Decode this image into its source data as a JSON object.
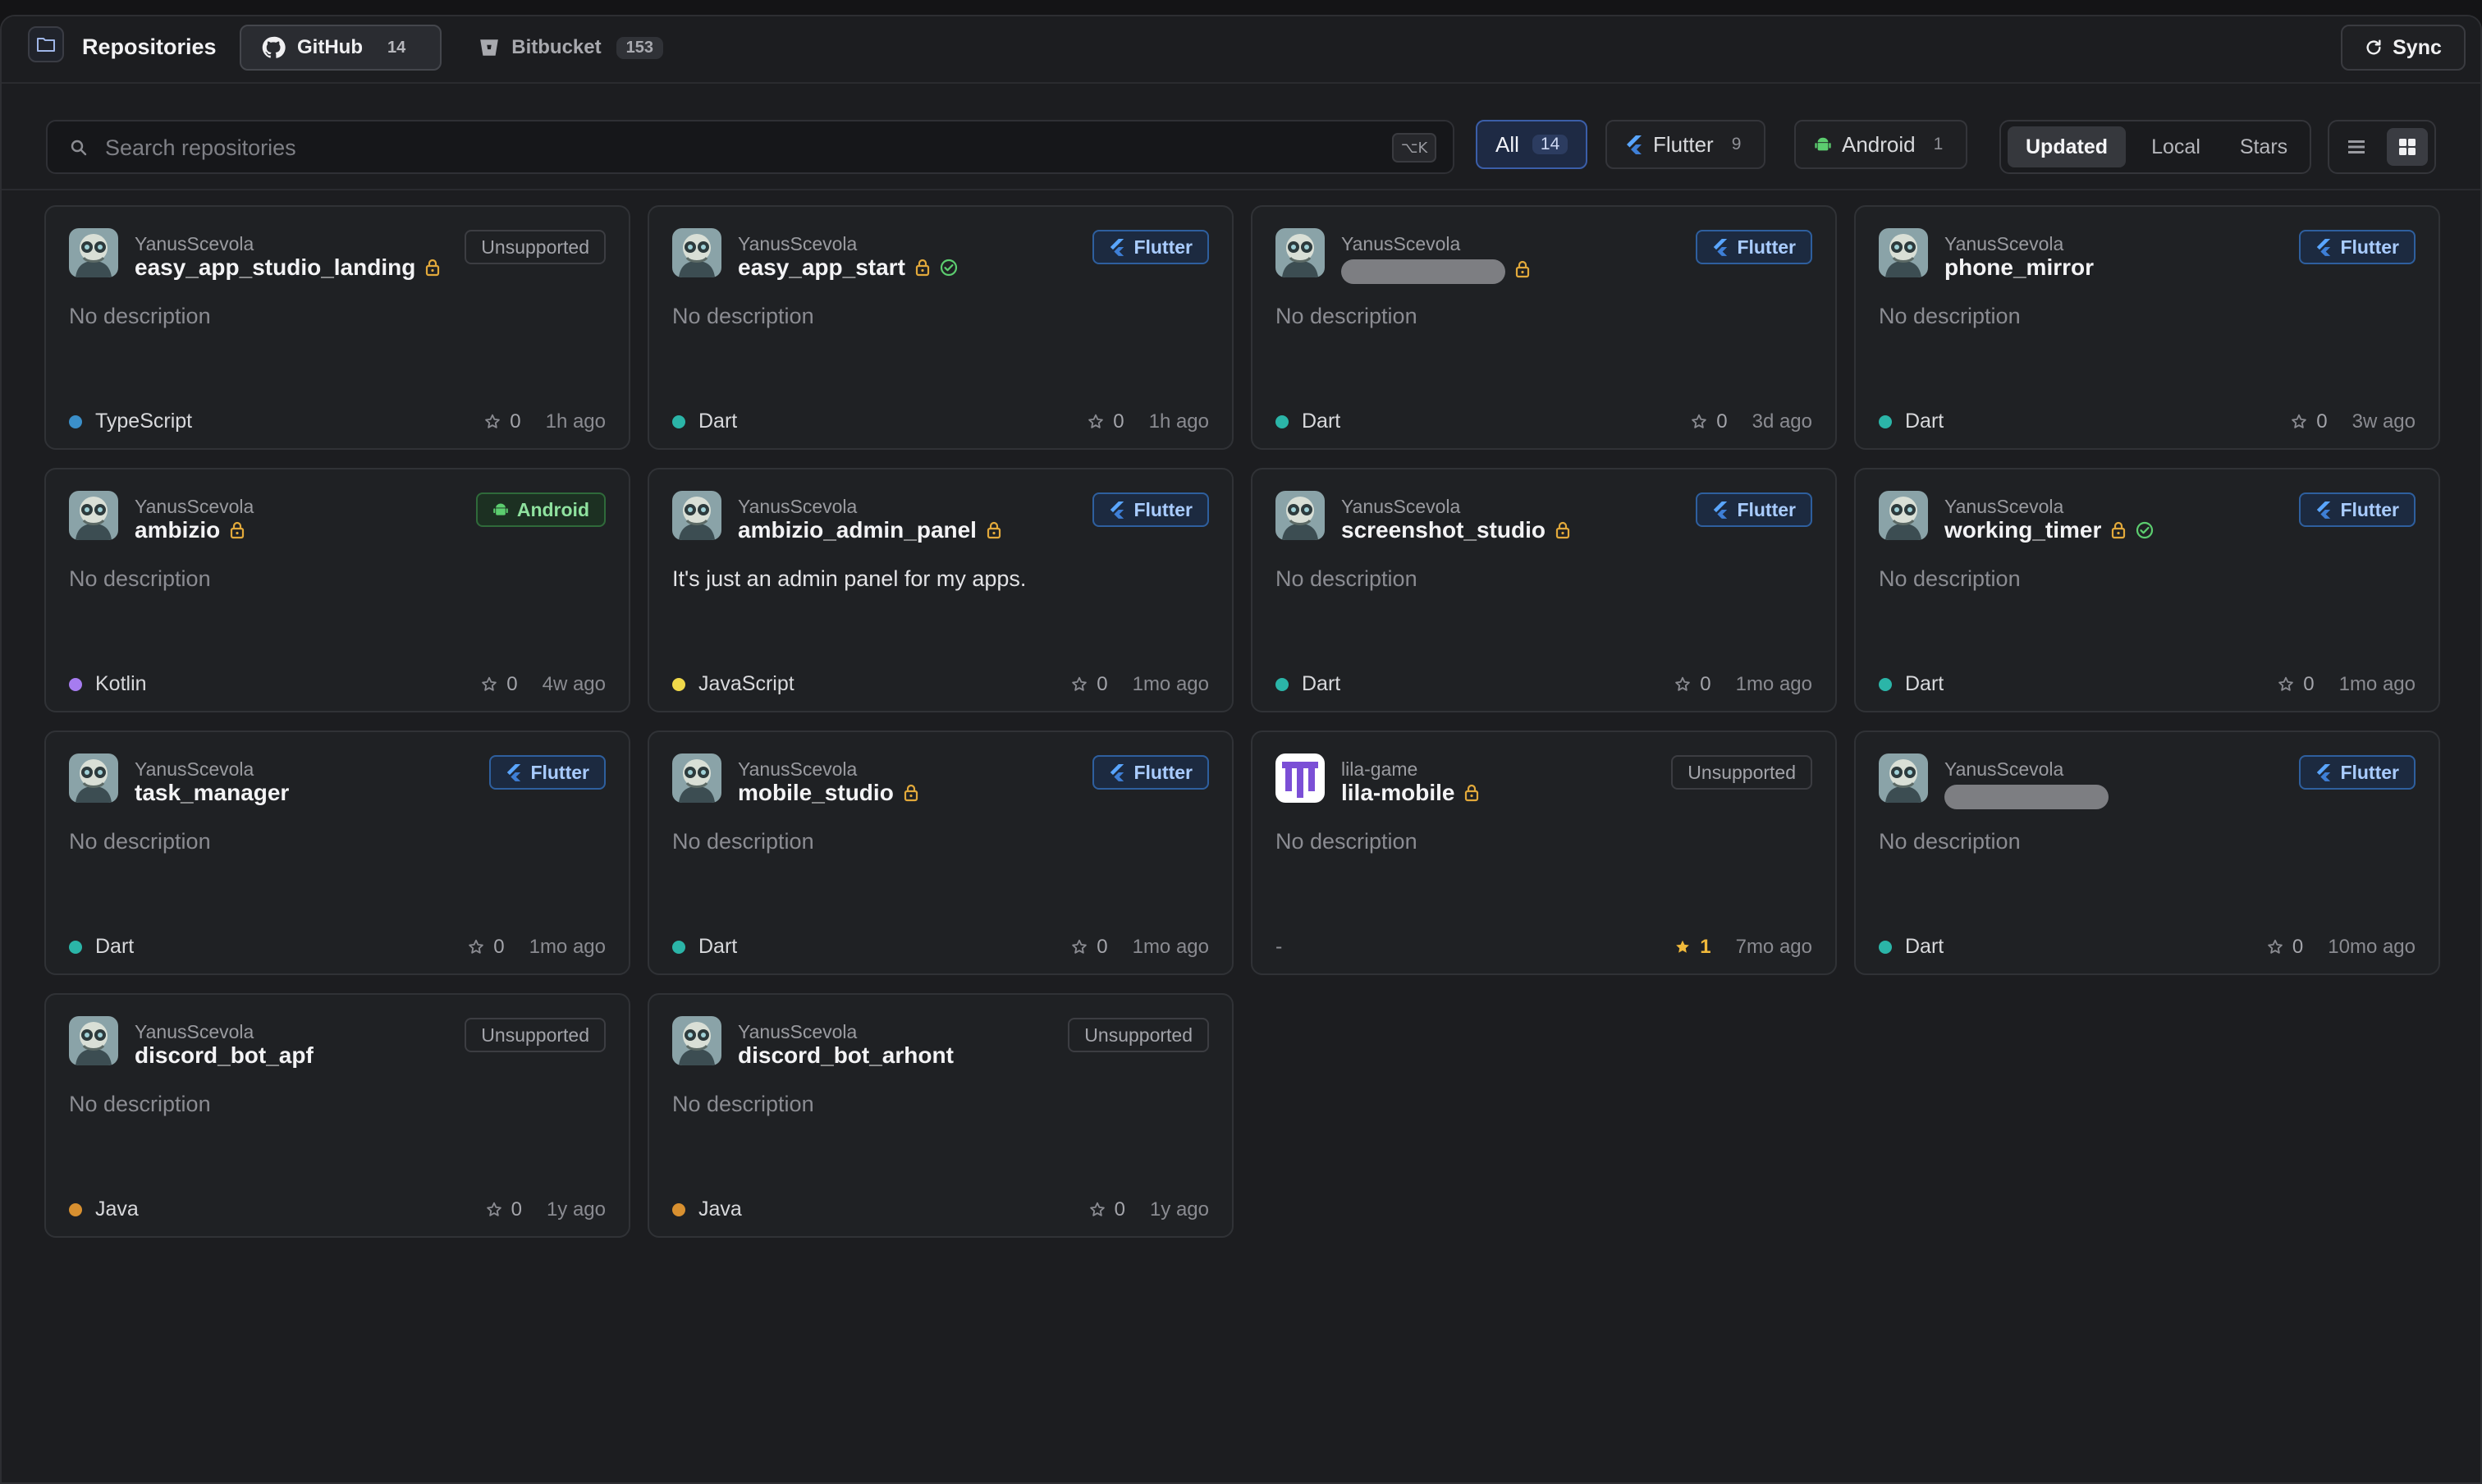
{
  "header": {
    "title": "Repositories",
    "tabs": [
      {
        "label": "GitHub",
        "count": "14"
      },
      {
        "label": "Bitbucket",
        "count": "153"
      }
    ],
    "sync_label": "Sync"
  },
  "filters": {
    "search_placeholder": "Search repositories",
    "shortcut": "⌥K",
    "chips": [
      {
        "label": "All",
        "count": "14"
      },
      {
        "label": "Flutter",
        "count": "9"
      },
      {
        "label": "Android",
        "count": "1"
      }
    ],
    "sort": [
      "Updated",
      "Local",
      "Stars"
    ]
  },
  "colors": {
    "flutter": "#5aa6ff",
    "android": "#5ccd6f",
    "lock": "#e2a93b",
    "check": "#5ccd6f",
    "star_active": "#f0b93b"
  },
  "cards": [
    {
      "owner": "YanusScevola",
      "name": "easy_app_studio_landing",
      "lock": true,
      "check": false,
      "badge": "Unsupported",
      "desc": "No description",
      "lang": "TypeScript",
      "lang_color": "#3b8fc9",
      "stars": "0",
      "time": "1h ago"
    },
    {
      "owner": "YanusScevola",
      "name": "easy_app_start",
      "lock": true,
      "check": true,
      "badge": "Flutter",
      "desc": "No description",
      "lang": "Dart",
      "lang_color": "#2bb5a8",
      "stars": "0",
      "time": "1h ago"
    },
    {
      "owner": "YanusScevola",
      "name": "",
      "lock": true,
      "check": false,
      "badge": "Flutter",
      "desc": "No description",
      "lang": "Dart",
      "lang_color": "#2bb5a8",
      "stars": "0",
      "time": "3d ago"
    },
    {
      "owner": "YanusScevola",
      "name": "phone_mirror",
      "lock": false,
      "check": false,
      "badge": "Flutter",
      "desc": "No description",
      "lang": "Dart",
      "lang_color": "#2bb5a8",
      "stars": "0",
      "time": "3w ago"
    },
    {
      "owner": "YanusScevola",
      "name": "ambizio",
      "lock": true,
      "check": false,
      "badge": "Android",
      "desc": "No description",
      "lang": "Kotlin",
      "lang_color": "#a67cf0",
      "stars": "0",
      "time": "4w ago"
    },
    {
      "owner": "YanusScevola",
      "name": "ambizio_admin_panel",
      "lock": true,
      "check": false,
      "badge": "Flutter",
      "desc": "It's just an admin panel for my apps.",
      "lang": "JavaScript",
      "lang_color": "#f0d94a",
      "stars": "0",
      "time": "1mo ago"
    },
    {
      "owner": "YanusScevola",
      "name": "screenshot_studio",
      "lock": true,
      "check": false,
      "badge": "Flutter",
      "desc": "No description",
      "lang": "Dart",
      "lang_color": "#2bb5a8",
      "stars": "0",
      "time": "1mo ago"
    },
    {
      "owner": "YanusScevola",
      "name": "working_timer",
      "lock": true,
      "check": true,
      "badge": "Flutter",
      "desc": "No description",
      "lang": "Dart",
      "lang_color": "#2bb5a8",
      "stars": "0",
      "time": "1mo ago"
    },
    {
      "owner": "YanusScevola",
      "name": "task_manager",
      "lock": false,
      "check": false,
      "badge": "Flutter",
      "desc": "No description",
      "lang": "Dart",
      "lang_color": "#2bb5a8",
      "stars": "0",
      "time": "1mo ago"
    },
    {
      "owner": "YanusScevola",
      "name": "mobile_studio",
      "lock": true,
      "check": false,
      "badge": "Flutter",
      "desc": "No description",
      "lang": "Dart",
      "lang_color": "#2bb5a8",
      "stars": "0",
      "time": "1mo ago"
    },
    {
      "owner": "lila-game",
      "name": "lila-mobile",
      "lock": true,
      "check": false,
      "badge": "Unsupported",
      "desc": "No description",
      "lang": "-",
      "lang_color": "",
      "stars": "1",
      "time": "7mo ago",
      "avatar": "lila"
    },
    {
      "owner": "YanusScevola",
      "name": "",
      "lock": false,
      "check": false,
      "badge": "Flutter",
      "desc": "No description",
      "lang": "Dart",
      "lang_color": "#2bb5a8",
      "stars": "0",
      "time": "10mo ago"
    },
    {
      "owner": "YanusScevola",
      "name": "discord_bot_apf",
      "lock": false,
      "check": false,
      "badge": "Unsupported",
      "desc": "No description",
      "lang": "Java",
      "lang_color": "#d89030",
      "stars": "0",
      "time": "1y ago"
    },
    {
      "owner": "YanusScevola",
      "name": "discord_bot_arhont",
      "lock": false,
      "check": false,
      "badge": "Unsupported",
      "desc": "No description",
      "lang": "Java",
      "lang_color": "#d89030",
      "stars": "0",
      "time": "1y ago"
    }
  ]
}
